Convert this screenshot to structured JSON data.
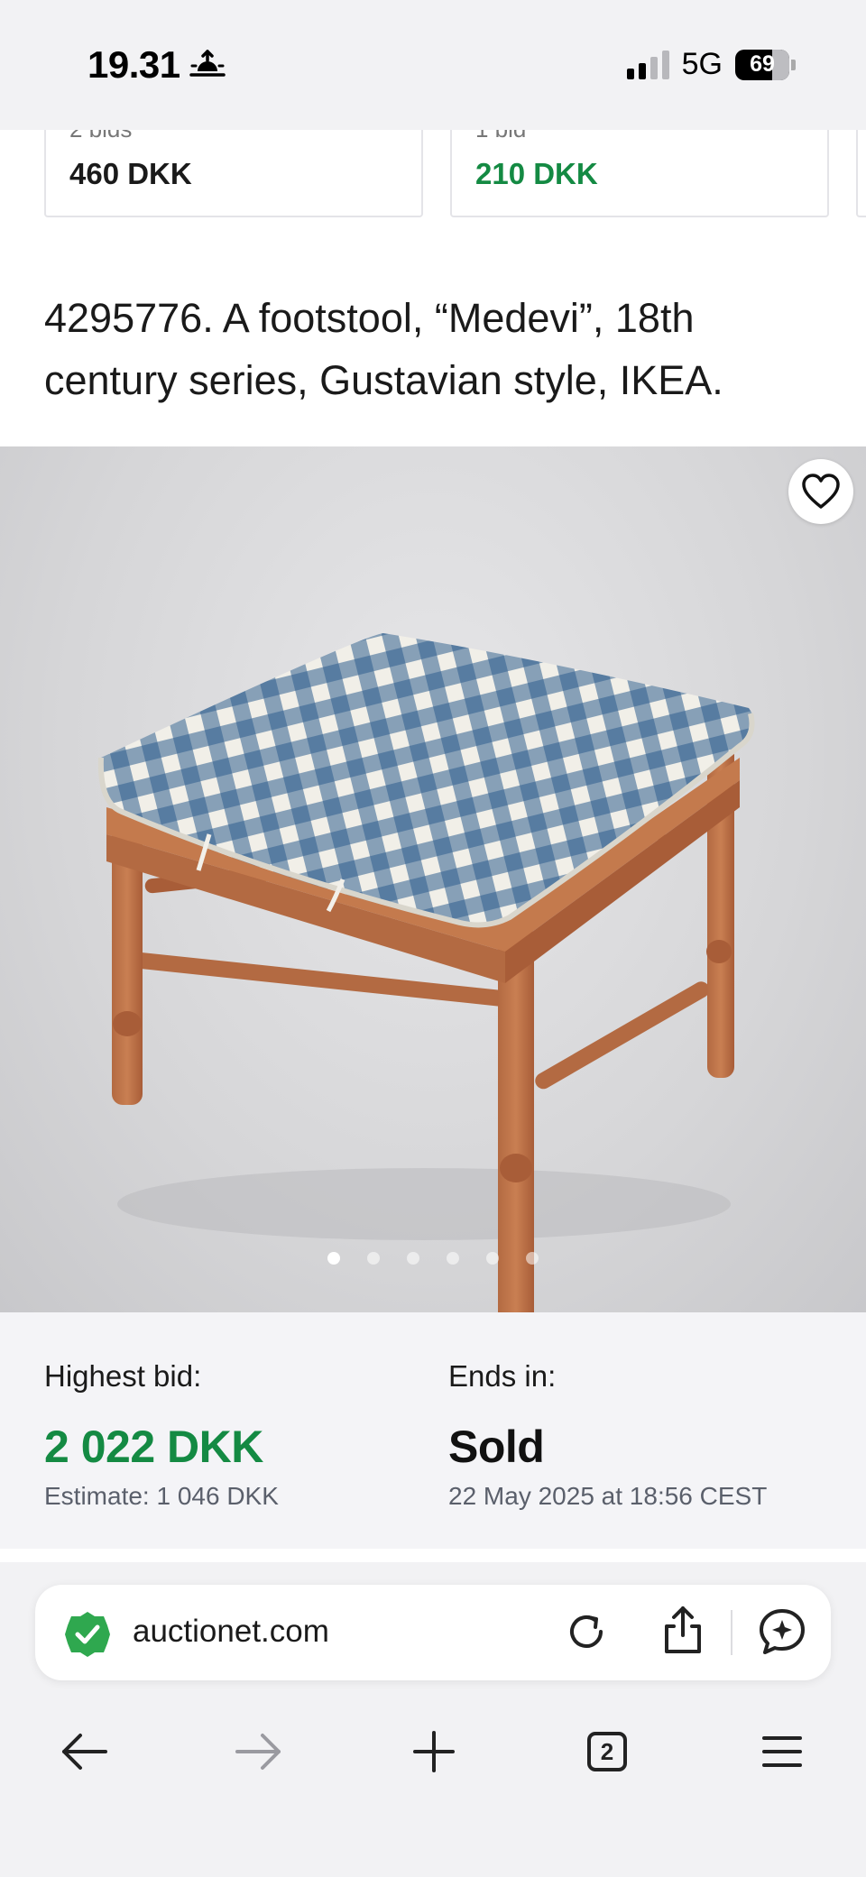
{
  "status_bar": {
    "time": "19.31",
    "network": "5G",
    "battery": "69"
  },
  "bid_cards": [
    {
      "bids": "2 bids",
      "price": "460 DKK",
      "color": "#1a1a1a"
    },
    {
      "bids": "1 bid",
      "price": "210 DKK",
      "color": "#148a43"
    }
  ],
  "lot": {
    "title": "4295776. A footstool, “Medevi”, 18th century series, Gustavian style, IKEA."
  },
  "gallery": {
    "image_count": 6,
    "active_index": 0
  },
  "bidding": {
    "highest_label": "Highest bid:",
    "highest_value": "2 022 DKK",
    "estimate": "Estimate: 1 046 DKK",
    "ends_label": "Ends in:",
    "ends_value": "Sold",
    "end_date": "22 May 2025 at 18:56 CEST",
    "accent_color": "#148a43"
  },
  "browser": {
    "url": "auctionet.com",
    "tab_count": "2"
  }
}
